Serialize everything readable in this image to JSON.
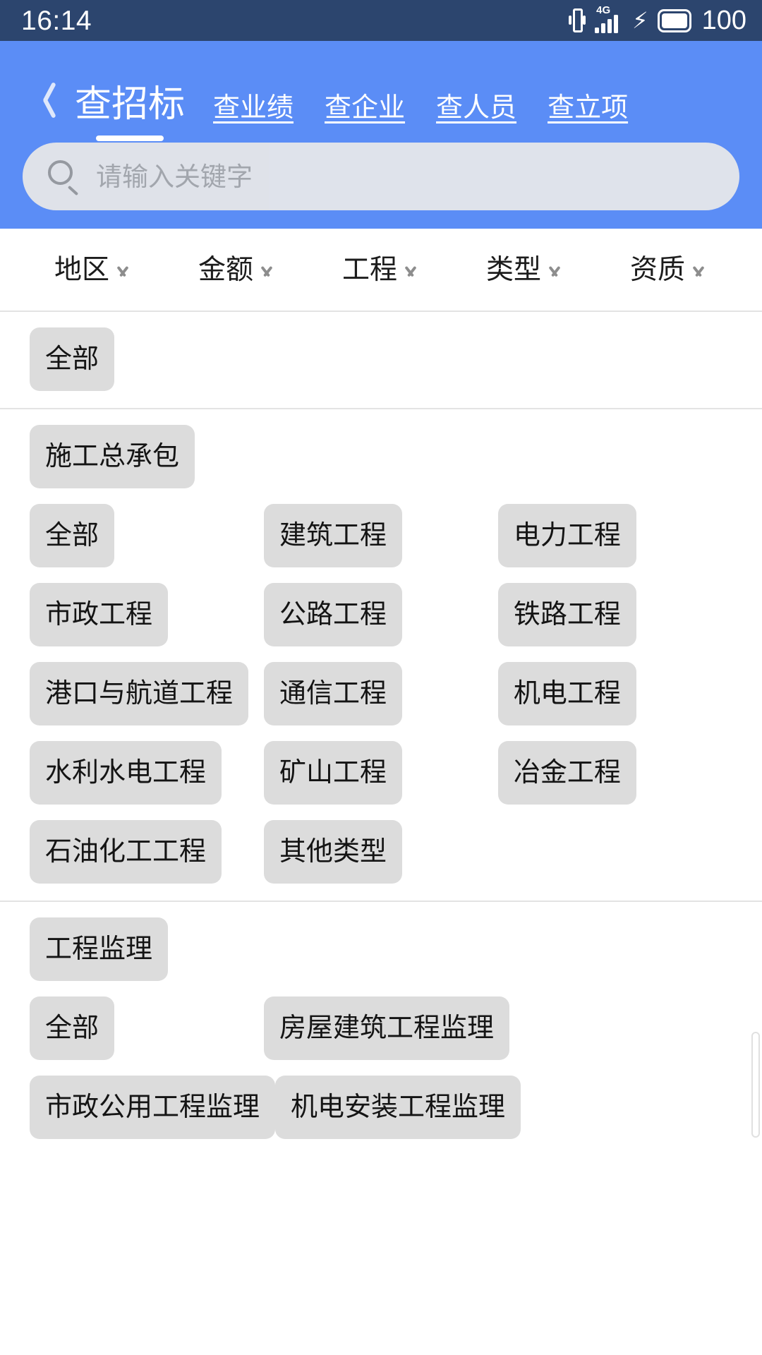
{
  "status_bar": {
    "time": "16:14",
    "battery_percent": "100",
    "network_label": "4G",
    "icons": [
      "vibrate-icon",
      "signal-4g-icon",
      "charging-bolt-icon",
      "battery-icon"
    ]
  },
  "header": {
    "back_icon": "back-chevron-icon",
    "tabs": [
      {
        "label": "查招标",
        "active": true
      },
      {
        "label": "查业绩",
        "active": false
      },
      {
        "label": "查企业",
        "active": false
      },
      {
        "label": "查人员",
        "active": false
      },
      {
        "label": "查立项",
        "active": false
      }
    ],
    "search": {
      "icon": "search-icon",
      "placeholder": "请输入关键字",
      "value": ""
    },
    "background_color": "#5b8df6"
  },
  "filter_bar": {
    "items": [
      {
        "label": "地区"
      },
      {
        "label": "金额"
      },
      {
        "label": "工程"
      },
      {
        "label": "类型"
      },
      {
        "label": "资质"
      }
    ]
  },
  "sections": [
    {
      "id": "all",
      "rows": [
        [
          "全部"
        ]
      ]
    },
    {
      "id": "general-construction-contracting",
      "rows": [
        [
          "施工总承包"
        ],
        [
          "全部",
          "建筑工程",
          "电力工程"
        ],
        [
          "市政工程",
          "公路工程",
          "铁路工程"
        ],
        [
          "港口与航道工程",
          "通信工程",
          "机电工程"
        ],
        [
          "水利水电工程",
          "矿山工程",
          "冶金工程"
        ],
        [
          "石油化工工程",
          "其他类型"
        ]
      ]
    },
    {
      "id": "engineering-supervision",
      "rows": [
        [
          "工程监理"
        ],
        [
          "全部",
          "房屋建筑工程监理"
        ],
        [
          "市政公用工程监理",
          "机电安装工程监理"
        ]
      ]
    }
  ],
  "colors": {
    "status_bar_bg": "#2c456e",
    "header_bg": "#5b8df6",
    "chip_bg": "#dcdcdc",
    "chip_text": "#141414",
    "divider": "#e3e3e3",
    "search_bg": "#e9e9e9",
    "placeholder_text": "#a8a8a8"
  }
}
